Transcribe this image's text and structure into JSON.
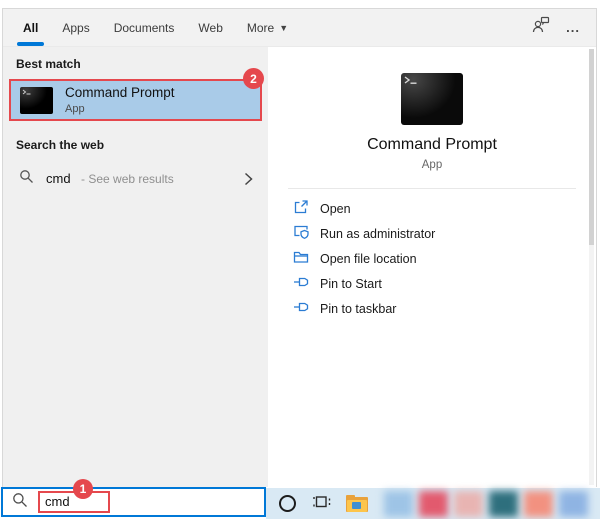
{
  "window": {
    "tabs": [
      {
        "label": "All",
        "active": true
      },
      {
        "label": "Apps",
        "active": false
      },
      {
        "label": "Documents",
        "active": false
      },
      {
        "label": "Web",
        "active": false
      },
      {
        "label": "More",
        "active": false
      }
    ],
    "glyphs": {
      "more_caret": "▼",
      "ellipsis": "...",
      "chevron": "›"
    }
  },
  "left_panel": {
    "best_match_header": "Best match",
    "best_match": {
      "title": "Command Prompt",
      "subtitle": "App"
    },
    "search_web_header": "Search the web",
    "web_result": {
      "query": "cmd",
      "suffix": "- See web results"
    }
  },
  "right_panel": {
    "title": "Command Prompt",
    "subtitle": "App",
    "actions": [
      {
        "label": "Open",
        "icon": "open-icon"
      },
      {
        "label": "Run as administrator",
        "icon": "admin-shield-icon"
      },
      {
        "label": "Open file location",
        "icon": "folder-icon"
      },
      {
        "label": "Pin to Start",
        "icon": "pin-icon"
      },
      {
        "label": "Pin to taskbar",
        "icon": "pin-icon"
      }
    ]
  },
  "search_bar": {
    "value": "cmd"
  },
  "annotations": {
    "step1": "1",
    "step2": "2",
    "color": "#e5484d"
  },
  "taskbar": {
    "icons": [
      "cortana-icon",
      "task-view-icon",
      "file-explorer-icon"
    ],
    "blurred_tiles": [
      "#9ec4e6",
      "#e25a6e",
      "#e8b4b2",
      "#2e6f7d",
      "#f29180",
      "#8fb4e3"
    ]
  },
  "colors": {
    "accent": "#0078d7",
    "highlight": "#a9cbe8",
    "left_bg": "#f0f0f0",
    "taskbar_bg": "#d9e9f4",
    "action_icon": "#2b7cd3"
  }
}
